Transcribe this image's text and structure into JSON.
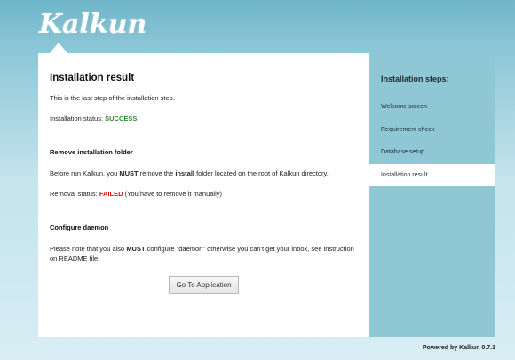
{
  "logo": {
    "text": "Kalkun"
  },
  "main": {
    "title": "Installation result",
    "intro": "This is the last step of the installation step.",
    "status_label": "Installation status:",
    "status_value": "SUCCESS",
    "remove_heading": "Remove installation folder",
    "remove_text_1": "Before run Kalkun, you ",
    "remove_must": "MUST",
    "remove_text_2": " remove the ",
    "remove_install": "install",
    "remove_text_3": " folder located on the root of Kalkun directory.",
    "removal_label": "Removal status:",
    "removal_value": "FAILED",
    "removal_note": " (You have to remove it manually)",
    "daemon_heading": "Configure daemon",
    "daemon_text_1": "Please note that you also ",
    "daemon_must": "MUST",
    "daemon_text_2": " configure \"daemon\" otherwise you can't get your inbox, see instruction on README file.",
    "button_label": "Go To Application"
  },
  "sidebar": {
    "title": "Installation steps:",
    "steps": [
      {
        "label": "Welcome screen"
      },
      {
        "label": "Requirement check"
      },
      {
        "label": "Database setup"
      },
      {
        "label": "Installation result"
      }
    ]
  },
  "footer": {
    "text": "Powered by Kalkun 0.7.1"
  },
  "colors": {
    "success": "#2e8b2e",
    "failed": "#d01818",
    "sidebar_bg": "#8fc7d5"
  }
}
